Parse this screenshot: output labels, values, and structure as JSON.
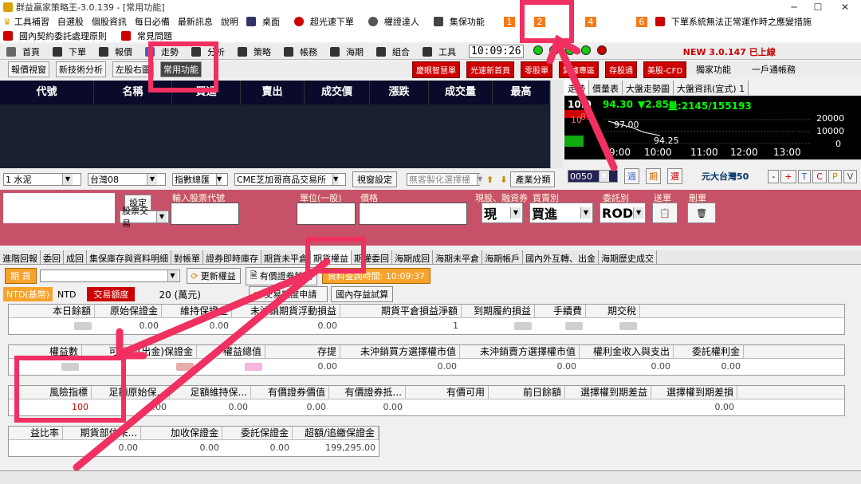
{
  "window": {
    "title": "群益贏家策略王-3.0.139 - [常用功能]"
  },
  "menu1": [
    "工具補習",
    "自選股",
    "個股資訊",
    "每日必備",
    "最新訊息",
    "說明",
    "桌面",
    "超光速下單",
    "權證達人",
    "集保功能"
  ],
  "menu1_badges": [
    "1",
    "2",
    "4",
    "6"
  ],
  "menu1_notice": "下單系統無法正常運作時之應變措施",
  "menu2": [
    "國內契約委託處理原則",
    "常見問題"
  ],
  "toolbar": {
    "items": [
      "首頁",
      "下單",
      "報價",
      "走勢",
      "分析",
      "策略",
      "帳務",
      "海期",
      "組合",
      "工具"
    ],
    "clock": "10:09:26",
    "version": "NEW 3.0.147 已上線"
  },
  "tabs": [
    "報價視窗",
    "新技術分析",
    "左股右圖",
    "常用功能"
  ],
  "red_buttons": [
    "慶眼智慧單",
    "光速新首頁",
    "零股單",
    "算據專區",
    "存股通",
    "美股-CFD"
  ],
  "right_buttons": [
    "獨家功能",
    "一戶通帳務"
  ],
  "quote_headers": [
    "代號",
    "名稱",
    "買進",
    "賣出",
    "成交價",
    "漲跌",
    "成交量",
    "最高"
  ],
  "chart_tabs": [
    "走勢",
    "價量表",
    "大盤走勢圖",
    "大盤資訊(宜式) 1"
  ],
  "chart": {
    "time": "10:0",
    "price": "94.30",
    "change": "▼2.85",
    "volume": "量:2145/155193",
    "p1": "97.00",
    "p2": "94.25",
    "y": [
      "20000",
      "10000",
      "0"
    ],
    "x": [
      "9:00",
      "10:00",
      "11:00",
      "12:00",
      "13:00"
    ],
    "h1": "10",
    "h2": "85"
  },
  "selectors": {
    "s1": "1 水泥",
    "s2": "台灣08",
    "s3": "指數總匯",
    "s4": "CME芝加哥商品交易所",
    "btn1": "視窗設定",
    "s5": "無客製化選擇權",
    "btn2": "產業分類"
  },
  "stock": {
    "code": "0050",
    "name": "元大台灣50",
    "btns": [
      "週",
      "期",
      "選"
    ],
    "ops": [
      "-",
      "+",
      "T",
      "C",
      "P",
      "V"
    ]
  },
  "order": {
    "set": "設定",
    "type": "股票交易",
    "qty_label": "輸入股票代號",
    "unit": "單位(一股)",
    "price_label": "價格",
    "cash_label": "現股、融資券",
    "trade_label": "買賣別",
    "trade": "買進",
    "cash": "現",
    "ord_label": "委託別",
    "ord": "ROD",
    "send": "送單",
    "del": "刪單"
  },
  "subtabs": [
    "進階回報",
    "委回",
    "成回",
    "集保庫存與資料明細",
    "對帳單",
    "證券即時庫存",
    "期貨未平倉",
    "期貨權益",
    "期權委回",
    "海期成回",
    "海期未平倉",
    "海期帳戶",
    "國內外互轉、出金",
    "海期歷史成交"
  ],
  "ctrl": {
    "label": "期 貨",
    "update": "更新權益",
    "valuable": "有價證券餘額",
    "query_time": "資料查詢時間: 10:09:37"
  },
  "currency": {
    "ntd_base": "NTD(基幣)",
    "ntd": "NTD",
    "quota_label": "交易額度",
    "quota": "20 (萬元)",
    "apply": "交易額度申請",
    "calc": "國內存益試算"
  },
  "grid1": {
    "headers": [
      "本日餘額",
      "原始保證金",
      "維持保證金",
      "未沖銷期貨浮動損益",
      "期貨平倉損益淨額",
      "到期履約損益",
      "手續費",
      "期交稅"
    ],
    "values": [
      "",
      "0.00",
      "0.00",
      "0.00",
      "1",
      "",
      "",
      ""
    ]
  },
  "grid2": {
    "headers": [
      "權益數",
      "可動用(出金)保證金",
      "權益總值",
      "存提",
      "未沖銷買方選擇權市值",
      "未沖銷賣方選擇權市值",
      "權利金收入與支出",
      "委託權利金"
    ],
    "values": [
      "",
      "",
      "",
      "0.00",
      "0.00",
      "0.00",
      "0.00",
      "0.00"
    ]
  },
  "grid3": {
    "headers": [
      "風險指標",
      "足額原始保...",
      "足額維持保...",
      "有價證券價值",
      "有價證券抵...",
      "有價可用",
      "前日餘額",
      "選擇權到期差益",
      "選擇權到期差損"
    ],
    "values": [
      "100",
      "0.00",
      "0.00",
      "0.00",
      "0.00",
      "",
      "",
      "",
      "0.00"
    ]
  },
  "grid4": {
    "headers": [
      "益比率",
      "期貨部位未...",
      "加收保證金",
      "委託保證金",
      "超額/追繳保證金"
    ],
    "values": [
      "",
      "0.00",
      "0.00",
      "0.00",
      "199,295.00"
    ]
  },
  "colors": {
    "accent": "#f03060",
    "panel": "#c8516a",
    "header": "#0a0a2a"
  }
}
